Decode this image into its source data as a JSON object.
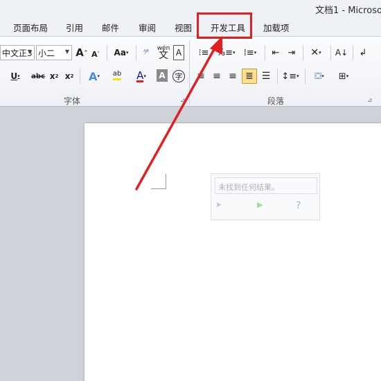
{
  "window": {
    "title": "文档1 - Microso"
  },
  "tabs": [
    {
      "label": "页面布局"
    },
    {
      "label": "引用"
    },
    {
      "label": "邮件"
    },
    {
      "label": "审阅"
    },
    {
      "label": "视图"
    },
    {
      "label": "开发工具"
    },
    {
      "label": "加载项"
    }
  ],
  "font_group": {
    "label": "字体",
    "font_name": "中文正3",
    "font_size": "小二",
    "grow_font": "A",
    "shrink_font": "A",
    "change_case": "Aa",
    "phonetic": "wén",
    "underline": "U",
    "strikethrough": "abc",
    "subscript": "x",
    "superscript": "x",
    "text_effect": "A",
    "highlight": "ab",
    "font_color": "A",
    "char_shading": "A",
    "enclose_char": "字"
  },
  "paragraph_group": {
    "label": "段落"
  },
  "document": {
    "popup_message": "未找到任何结果。"
  },
  "colors": {
    "annotation_red": "#e02020",
    "selected_fill": "#ffe08c"
  }
}
